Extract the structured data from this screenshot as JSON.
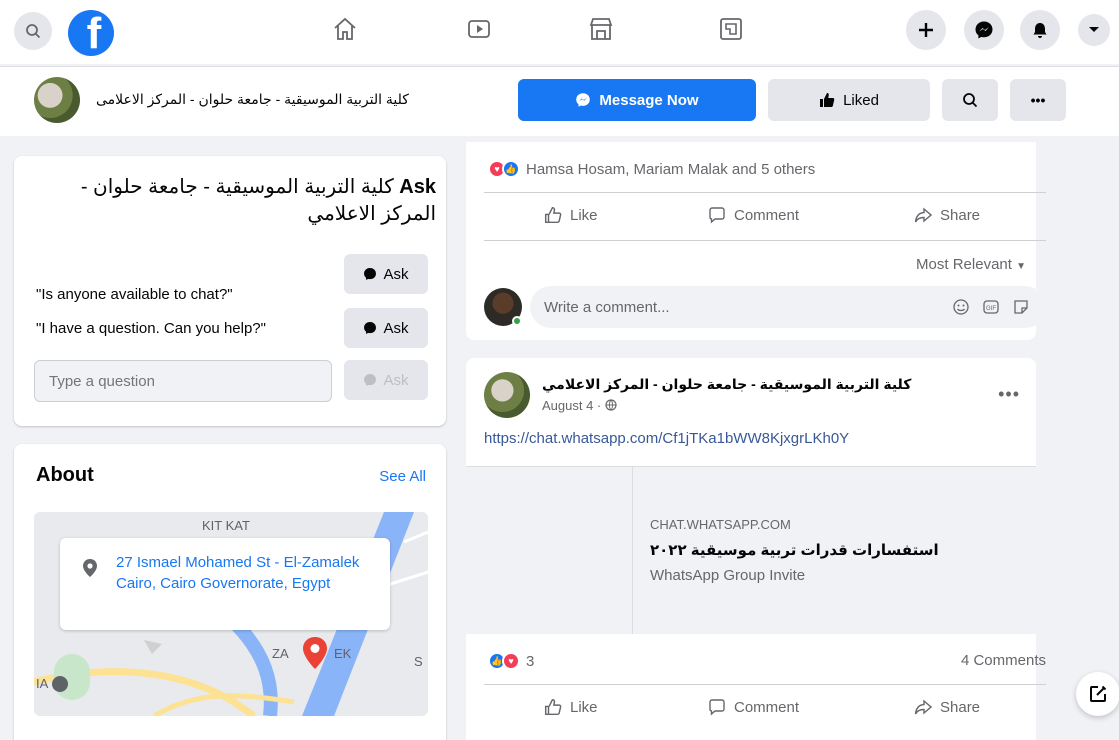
{
  "topnav": {
    "icons": [
      "search-icon",
      "facebook-logo",
      "home-icon",
      "watch-icon",
      "marketplace-icon",
      "gaming-icon",
      "create-icon",
      "messenger-icon",
      "notifications-icon",
      "account-menu-icon"
    ]
  },
  "page_header": {
    "title": "كلية التربية الموسيقية - جامعة حلوان - المركز الاعلامى",
    "message_now": "Message Now",
    "liked": "Liked",
    "colors": {
      "primary": "#1877f2",
      "secondary": "#e4e6eb"
    }
  },
  "ask_card": {
    "title_bold": "Ask",
    "title_rest": "كلية التربية الموسيقية - جامعة حلوان - المركز الاعلامي",
    "questions": [
      {
        "text": "\"Is anyone available to chat?\"",
        "button": "Ask"
      },
      {
        "text": "\"I have a question. Can you help?\"",
        "button": "Ask"
      }
    ],
    "input_placeholder": "Type a question",
    "input_button": "Ask"
  },
  "about_card": {
    "title": "About",
    "see_all": "See All",
    "address": "27 Ismael Mohamed St - El-Zamalek Cairo, Cairo Governorate, Egypt",
    "map_labels": {
      "kitkat": "KIT KAT",
      "zamalek_left": "ZA",
      "zamalek_right": "EK",
      "s": "S",
      "ia": "IA"
    }
  },
  "post1": {
    "reactions_text": "Hamsa Hosam, Mariam Malak and 5 others",
    "actions": {
      "like": "Like",
      "comment": "Comment",
      "share": "Share"
    },
    "sort": "Most Relevant",
    "comment_placeholder": "Write a comment..."
  },
  "post2": {
    "author": "كلية التربية الموسيقية - جامعة حلوان - المركز الاعلامي",
    "date": "August 4 · ",
    "link": "https://chat.whatsapp.com/Cf1jTKa1bWW8KjxgrLKh0Y",
    "preview": {
      "domain": "CHAT.WHATSAPP.COM",
      "title": "استفسارات قدرات تربية موسيقية ٢٠٢٢",
      "subtitle": "WhatsApp Group Invite"
    },
    "reaction_count": "3",
    "comments_count": "4 Comments",
    "actions": {
      "like": "Like",
      "comment": "Comment",
      "share": "Share"
    }
  }
}
